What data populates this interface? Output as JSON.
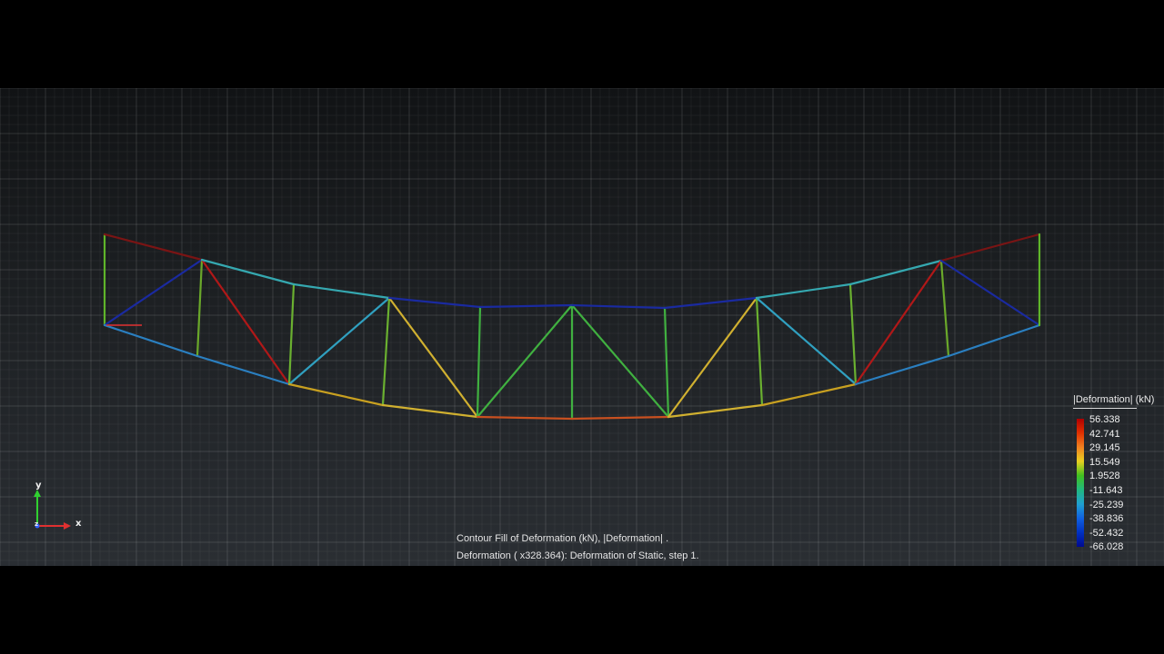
{
  "legend": {
    "title": "|Deformation| (kN)",
    "values": [
      "56.338",
      "42.741",
      "29.145",
      "15.549",
      "1.9528",
      "-11.643",
      "-25.239",
      "-38.836",
      "-52.432",
      "-66.028"
    ],
    "colors": [
      "#b00000",
      "#e03000",
      "#f08020",
      "#e8d020",
      "#40c020",
      "#20b880",
      "#20a0d0",
      "#1060e0",
      "#0030c0",
      "#000a90"
    ]
  },
  "caption": {
    "line1": "Contour Fill of Deformation (kN),  |Deformation| .",
    "line2": "Deformation ( x328.364): Deformation of Static, step 1."
  },
  "axes": {
    "y_label": "y",
    "x_label": "x",
    "z_label": "z"
  },
  "truss": {
    "members": [
      {
        "from": "T0",
        "to": "B0",
        "color": "#5fb52a"
      },
      {
        "from": "T0",
        "to": "T1",
        "color": "#7a1414"
      },
      {
        "from": "B0",
        "to": "T1",
        "color": "#1a2aa0"
      },
      {
        "from": "B0",
        "to": "B1",
        "color": "#2a7fc0"
      },
      {
        "from": "T1",
        "to": "B1",
        "color": "#6aa82a"
      },
      {
        "from": "T1",
        "to": "B2",
        "color": "#b01818"
      },
      {
        "from": "T1",
        "to": "T2",
        "color": "#35a8b0"
      },
      {
        "from": "B1",
        "to": "B2",
        "color": "#2a7fc0"
      },
      {
        "from": "T2",
        "to": "B2",
        "color": "#6ab030"
      },
      {
        "from": "T2",
        "to": "T3",
        "color": "#35a8b0"
      },
      {
        "from": "B2",
        "to": "T3",
        "color": "#30a0c0"
      },
      {
        "from": "B2",
        "to": "B3",
        "color": "#c8a020"
      },
      {
        "from": "T3",
        "to": "B3",
        "color": "#6ab030"
      },
      {
        "from": "T3",
        "to": "B4",
        "color": "#d0b030"
      },
      {
        "from": "T3",
        "to": "T4",
        "color": "#1a2aa0"
      },
      {
        "from": "B3",
        "to": "B4",
        "color": "#d0b030"
      },
      {
        "from": "T4",
        "to": "B4",
        "color": "#40b040"
      },
      {
        "from": "B4",
        "to": "T5",
        "color": "#40b040"
      },
      {
        "from": "T4",
        "to": "T5",
        "color": "#1a2aa0"
      },
      {
        "from": "T5",
        "to": "B5",
        "color": "#40b040"
      },
      {
        "from": "B4",
        "to": "B5",
        "color": "#c85020"
      },
      {
        "from": "T5",
        "to": "B6",
        "color": "#40b040"
      },
      {
        "from": "B5",
        "to": "B6",
        "color": "#c85020"
      },
      {
        "from": "T5",
        "to": "T6",
        "color": "#1a2aa0"
      },
      {
        "from": "T6",
        "to": "B6",
        "color": "#40b040"
      },
      {
        "from": "B6",
        "to": "T7",
        "color": "#d0b030"
      },
      {
        "from": "T6",
        "to": "T7",
        "color": "#1a2aa0"
      },
      {
        "from": "T7",
        "to": "B7",
        "color": "#6ab030"
      },
      {
        "from": "B6",
        "to": "B7",
        "color": "#d0b030"
      },
      {
        "from": "T7",
        "to": "B8",
        "color": "#30a0c0"
      },
      {
        "from": "T7",
        "to": "T8",
        "color": "#35a8b0"
      },
      {
        "from": "B7",
        "to": "B8",
        "color": "#c8a020"
      },
      {
        "from": "T8",
        "to": "B8",
        "color": "#6ab030"
      },
      {
        "from": "T8",
        "to": "T9",
        "color": "#35a8b0"
      },
      {
        "from": "B8",
        "to": "T9",
        "color": "#b01818"
      },
      {
        "from": "B8",
        "to": "B9",
        "color": "#2a7fc0"
      },
      {
        "from": "T9",
        "to": "B9",
        "color": "#6aa82a"
      },
      {
        "from": "T9",
        "to": "T10",
        "color": "#7a1414"
      },
      {
        "from": "T9",
        "to": "B10",
        "color": "#1a2aa0"
      },
      {
        "from": "B9",
        "to": "B10",
        "color": "#2a7fc0"
      },
      {
        "from": "T10",
        "to": "B10",
        "color": "#5fb52a"
      }
    ]
  }
}
